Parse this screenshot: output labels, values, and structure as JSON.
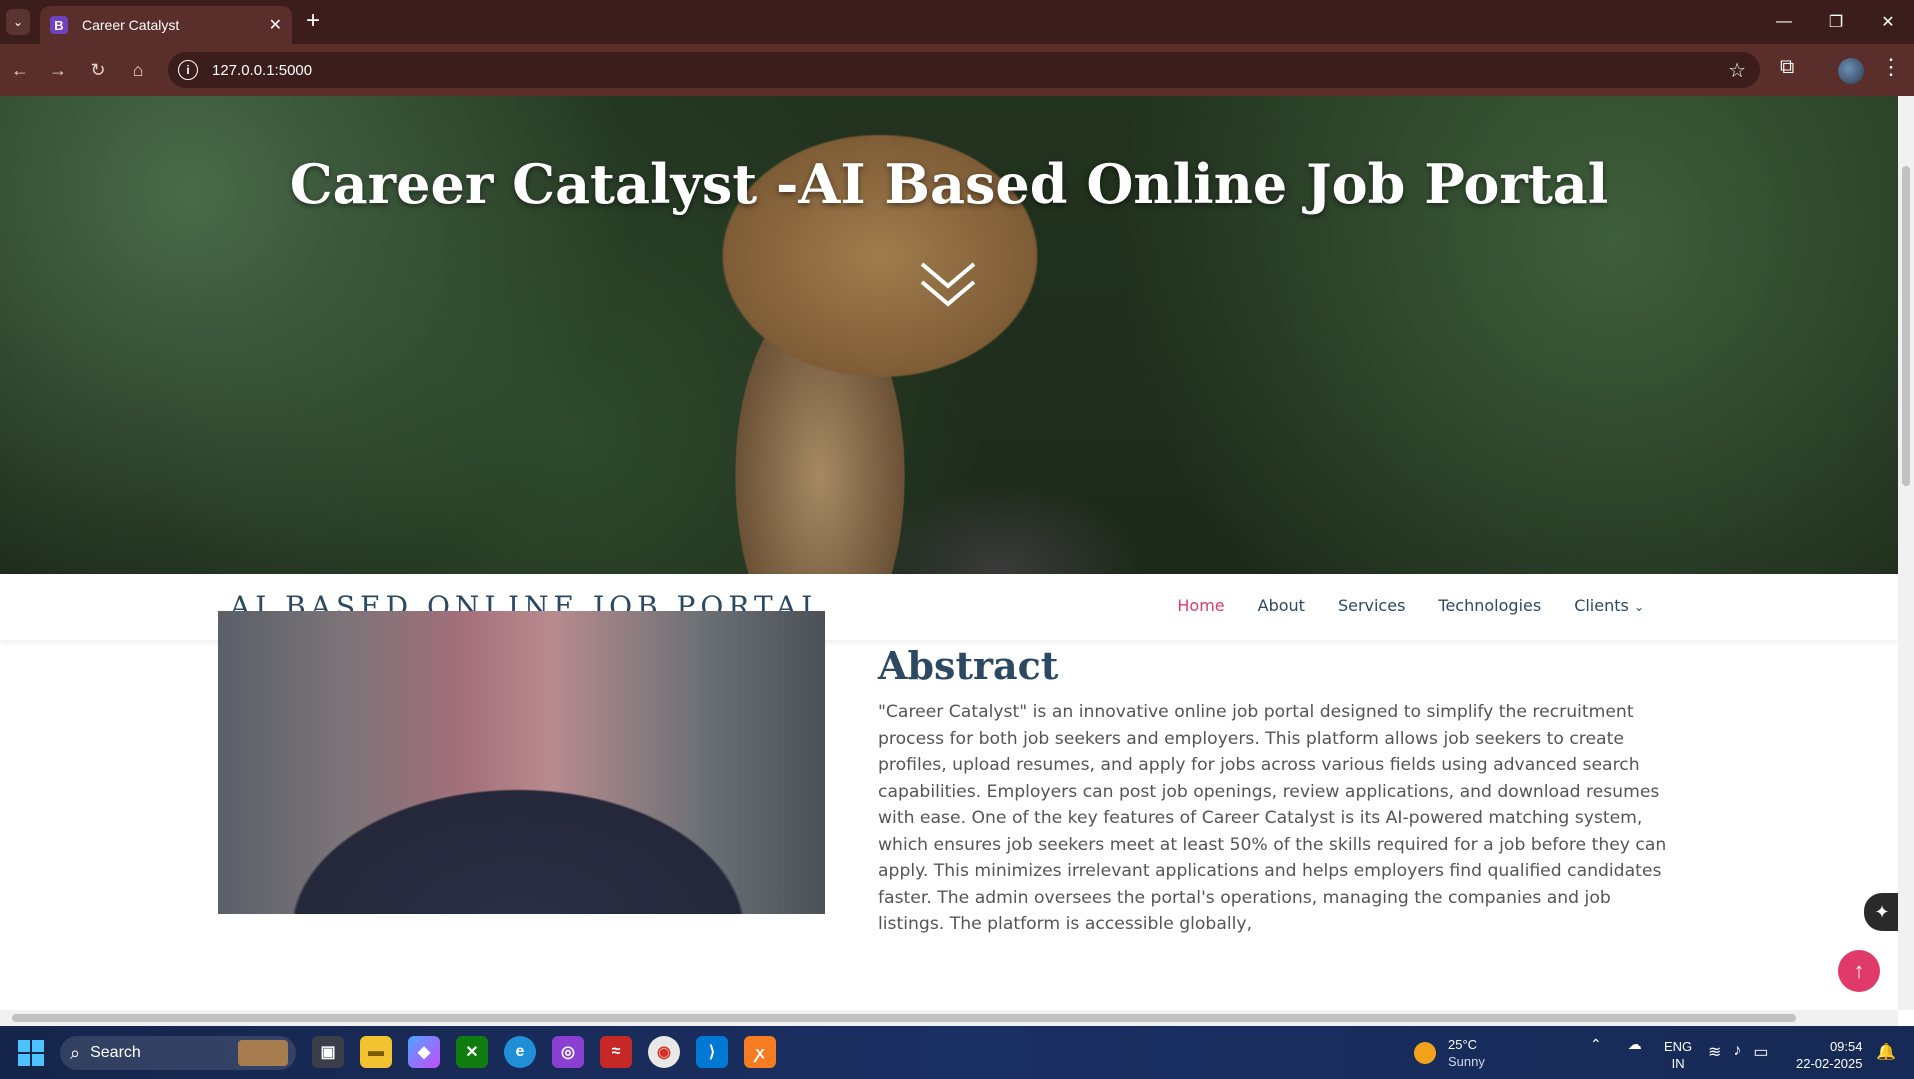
{
  "browser": {
    "tab_favicon": "B",
    "tab_title": "Career Catalyst",
    "url": "127.0.0.1:5000"
  },
  "hero": {
    "title": "Career Catalyst -AI Based Online Job Portal"
  },
  "navbar": {
    "brand": "AI BASED ONLINE JOB PORTAL",
    "links": [
      "Home",
      "About",
      "Services",
      "Technologies",
      "Clients"
    ],
    "active": "Home",
    "accent_color": "#e03a6b",
    "text_color": "#2c4964"
  },
  "about": {
    "heading": "Abstract",
    "text": "\"Career Catalyst\" is an innovative online job portal designed to simplify the recruitment process for both job seekers and employers. This platform allows job seekers to create profiles, upload resumes, and apply for jobs across various fields using advanced search capabilities. Employers can post job openings, review applications, and download resumes with ease. One of the key features of Career Catalyst is its AI-powered matching system, which ensures job seekers meet at least 50% of the skills required for a job before they can apply. This minimizes irrelevant applications and helps employers find qualified candidates faster. The admin oversees the portal's operations, managing the companies and job listings. The platform is accessible globally,"
  },
  "taskbar": {
    "search_label": "Search",
    "weather_temp": "25°C",
    "weather_desc": "Sunny",
    "lang_top": "ENG",
    "lang_bottom": "IN",
    "time": "09:54",
    "date": "22-02-2025"
  }
}
